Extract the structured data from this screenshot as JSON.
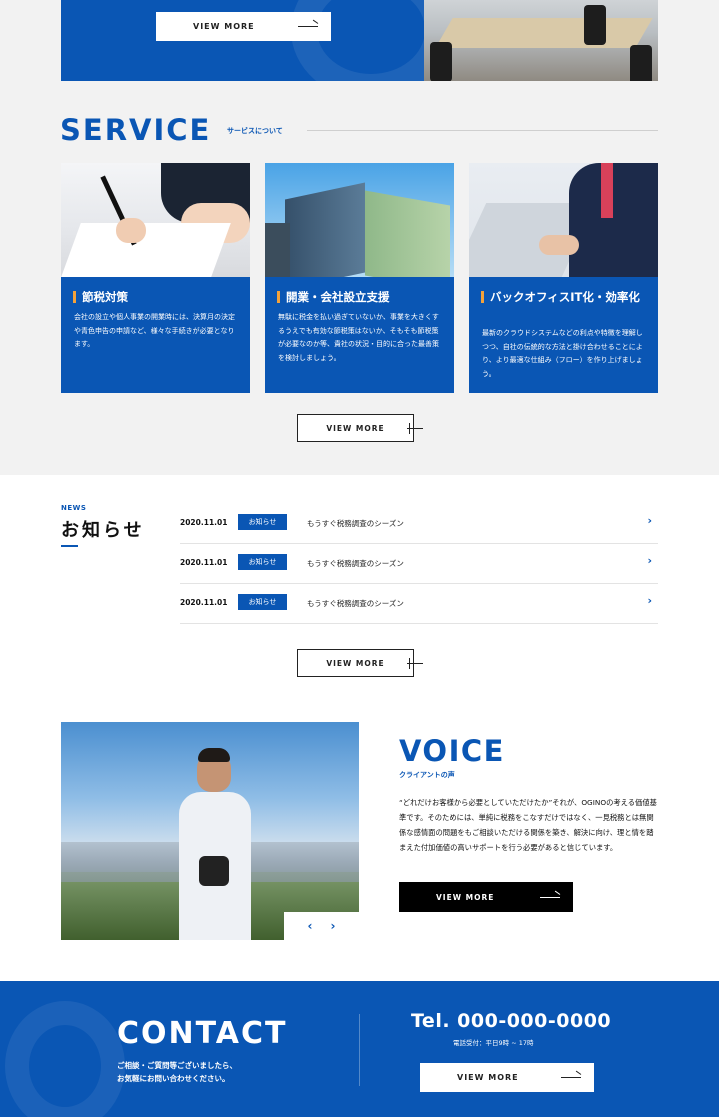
{
  "hero": {
    "button_label": "VIEW MORE"
  },
  "service": {
    "title": "SERVICE",
    "subtitle": "サービスについて",
    "cards": [
      {
        "title": "節税対策",
        "body": "会社の設立や個人事業の開業時には、決算月の決定や青色申告の申請など、様々な手続きが必要となります。"
      },
      {
        "title": "開業・会社設立支援",
        "body": "無駄に税金を払い過ぎていないか、事業を大きくするうえでも有効な節税策はないか、そもそも節税策が必要なのか等、貴社の状況・目的に合った最善策を検討しましょう。"
      },
      {
        "title": "バックオフィスIT化・効率化",
        "body": "最新のクラウドシステムなどの利点や特徴を理解しつつ、自社の伝統的な方法と掛け合わせることにより、より最適な仕組み（フロー）を作り上げましょう。"
      }
    ],
    "button_label": "VIEW MORE"
  },
  "news": {
    "label_en": "NEWS",
    "label_ja": "お知らせ",
    "items": [
      {
        "date": "2020.11.01",
        "tag": "お知らせ",
        "text": "もうすぐ税務調査のシーズン"
      },
      {
        "date": "2020.11.01",
        "tag": "お知らせ",
        "text": "もうすぐ税務調査のシーズン"
      },
      {
        "date": "2020.11.01",
        "tag": "お知らせ",
        "text": "もうすぐ税務調査のシーズン"
      }
    ],
    "button_label": "VIEW MORE"
  },
  "voice": {
    "title": "VOICE",
    "subtitle": "クライアントの声",
    "body": "“どれだけお客様から必要としていただけたか”それが、OGINOの考える価値基準です。そのためには、単純に税務をこなすだけではなく、一見税務とは無関係な感情面の問題をもご相談いただける関係を築き、解決に向け、理と情を踏まえた付加価値の高いサポートを行う必要があると信じています。",
    "button_label": "VIEW MORE",
    "prev": "‹",
    "next": "›"
  },
  "contact": {
    "title": "CONTACT",
    "desc_line1": "ご相談・ご質問等ございましたら、",
    "desc_line2": "お気軽にお問い合わせください。",
    "tel": "Tel. 000-000-0000",
    "hours": "電話受付：平日9時 ~ 17時",
    "button_label": "VIEW MORE"
  },
  "colors": {
    "brand_blue": "#0a56b4",
    "accent_orange": "#f3a23b"
  }
}
